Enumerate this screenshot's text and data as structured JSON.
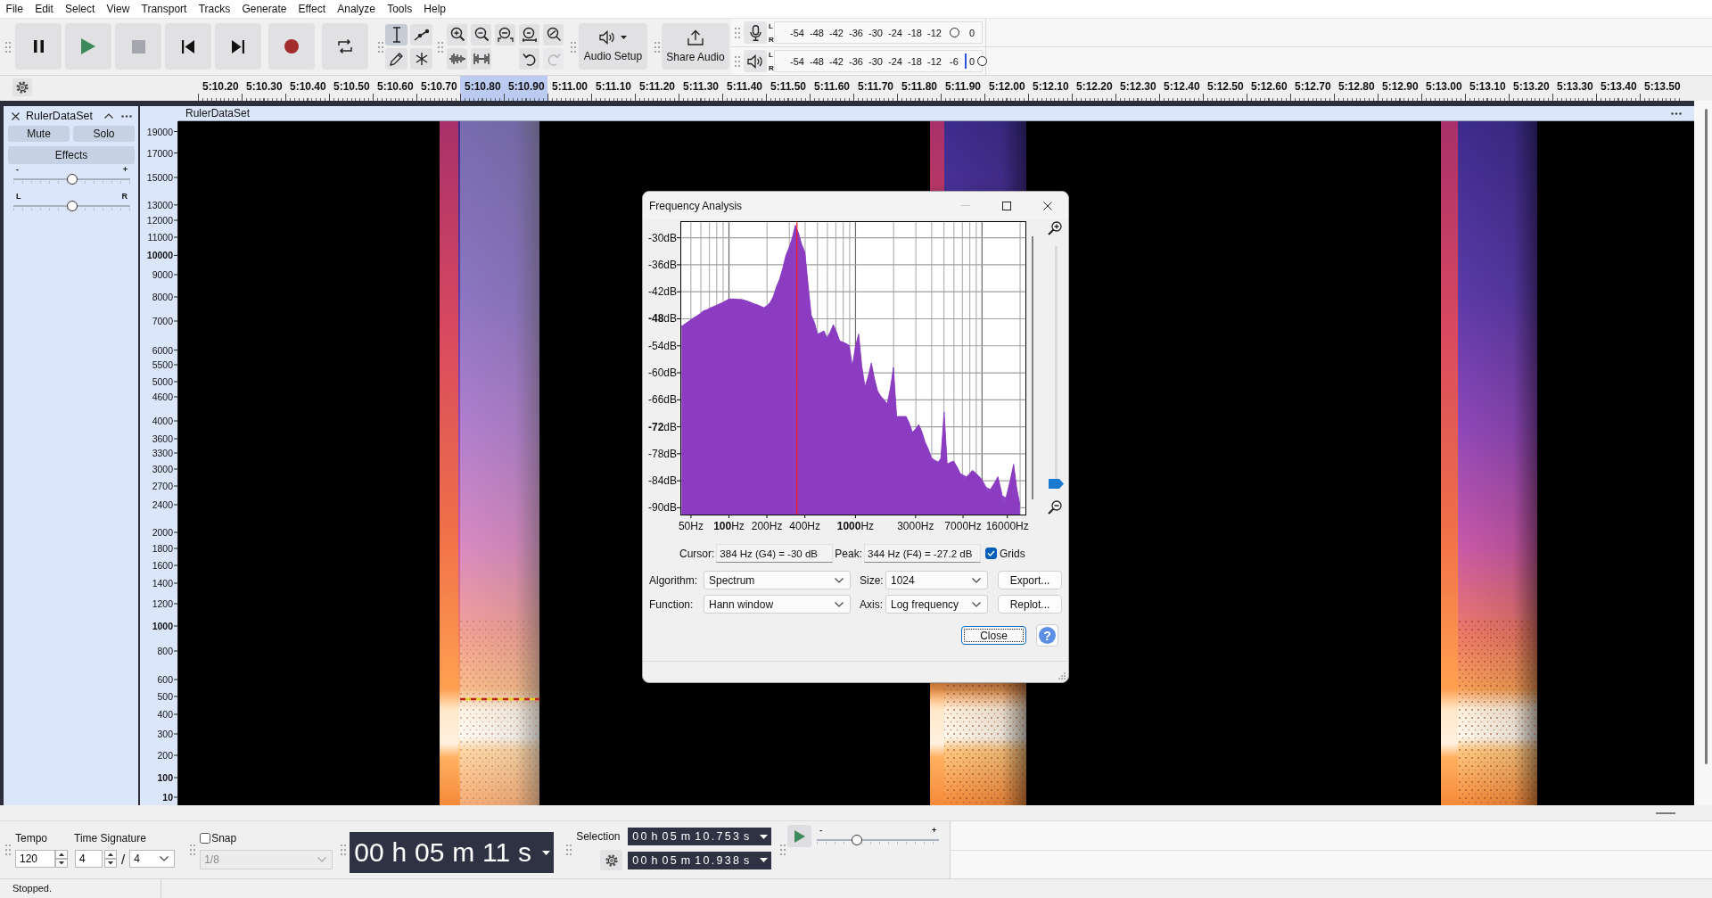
{
  "menu_bar": [
    "File",
    "Edit",
    "Select",
    "View",
    "Transport",
    "Tracks",
    "Generate",
    "Effect",
    "Analyze",
    "Tools",
    "Help"
  ],
  "tools": [
    {
      "selected": true
    },
    {
      "selected": false
    },
    {
      "selected": false
    },
    {
      "selected": false
    }
  ],
  "undo_redo": [
    {
      "disabled": false
    },
    {
      "disabled": true
    }
  ],
  "audio_setup": {
    "label": "Audio Setup"
  },
  "share_audio": {
    "label": "Share Audio"
  },
  "record_meter": {
    "channels": [
      "L",
      "R"
    ],
    "ticks": [
      "-54",
      "-48",
      "-42",
      "-36",
      "-30",
      "-24",
      "-18",
      "-12",
      "0"
    ],
    "slider": {
      "level": 0.86
    }
  },
  "playback_meter": {
    "channels": [
      "L",
      "R"
    ],
    "ticks": [
      "-54",
      "-48",
      "-42",
      "-36",
      "-30",
      "-24",
      "-18",
      "-12",
      "-6",
      "0"
    ],
    "peak": {
      "level": 0.91
    },
    "slider": {
      "level": 0.995
    }
  },
  "timeline": {
    "labels": [
      {
        "text": "5:10.20",
        "selected": false
      },
      {
        "text": "5:10.30",
        "selected": false
      },
      {
        "text": "5:10.40",
        "selected": false
      },
      {
        "text": "5:10.50",
        "selected": false
      },
      {
        "text": "5:10.60",
        "selected": false
      },
      {
        "text": "5:10.70",
        "selected": false
      },
      {
        "text": "5:10.80",
        "selected": true
      },
      {
        "text": "5:10.90",
        "selected": true
      },
      {
        "text": "5:11.00",
        "selected": false
      },
      {
        "text": "5:11.10",
        "selected": false
      },
      {
        "text": "5:11.20",
        "selected": false
      },
      {
        "text": "5:11.30",
        "selected": false
      },
      {
        "text": "5:11.40",
        "selected": false
      },
      {
        "text": "5:11.50",
        "selected": false
      },
      {
        "text": "5:11.60",
        "selected": false
      },
      {
        "text": "5:11.70",
        "selected": false
      },
      {
        "text": "5:11.80",
        "selected": false
      },
      {
        "text": "5:11.90",
        "selected": false
      },
      {
        "text": "5:12.00",
        "selected": false
      },
      {
        "text": "5:12.10",
        "selected": false
      },
      {
        "text": "5:12.20",
        "selected": false
      },
      {
        "text": "5:12.30",
        "selected": false
      },
      {
        "text": "5:12.40",
        "selected": false
      },
      {
        "text": "5:12.50",
        "selected": false
      },
      {
        "text": "5:12.60",
        "selected": false
      },
      {
        "text": "5:12.70",
        "selected": false
      },
      {
        "text": "5:12.80",
        "selected": false
      },
      {
        "text": "5:12.90",
        "selected": false
      },
      {
        "text": "5:13.00",
        "selected": false
      },
      {
        "text": "5:13.10",
        "selected": false
      },
      {
        "text": "5:13.20",
        "selected": false
      },
      {
        "text": "5:13.30",
        "selected": false
      },
      {
        "text": "5:13.40",
        "selected": false
      },
      {
        "text": "5:13.50",
        "selected": false
      }
    ]
  },
  "track": {
    "name": "RulerDataSet",
    "mute": "Mute",
    "solo": "Solo",
    "effects": "Effects",
    "gain": {
      "min_label": "-",
      "max_label": "+",
      "level": 0.5
    },
    "pan": {
      "min_label": "L",
      "max_label": "R",
      "level": 0.5
    },
    "title_bar": "RulerDataSet"
  },
  "frequency_ruler": [
    {
      "text": "19000",
      "major": false
    },
    {
      "text": "17000",
      "major": false
    },
    {
      "text": "15000",
      "major": false
    },
    {
      "text": "13000",
      "major": false
    },
    {
      "text": "12000",
      "major": false
    },
    {
      "text": "11000",
      "major": false
    },
    {
      "text": "10000",
      "major": true
    },
    {
      "text": "9000",
      "major": false
    },
    {
      "text": "8000",
      "major": false
    },
    {
      "text": "7000",
      "major": false
    },
    {
      "text": "6000",
      "major": false
    },
    {
      "text": "5500",
      "major": false
    },
    {
      "text": "5000",
      "major": false
    },
    {
      "text": "4600",
      "major": false
    },
    {
      "text": "4000",
      "major": false
    },
    {
      "text": "3600",
      "major": false
    },
    {
      "text": "3300",
      "major": false
    },
    {
      "text": "3000",
      "major": false
    },
    {
      "text": "2700",
      "major": false
    },
    {
      "text": "2400",
      "major": false
    },
    {
      "text": "2000",
      "major": false
    },
    {
      "text": "1800",
      "major": false
    },
    {
      "text": "1600",
      "major": false
    },
    {
      "text": "1400",
      "major": false
    },
    {
      "text": "1200",
      "major": false
    },
    {
      "text": "1000",
      "major": true
    },
    {
      "text": "800",
      "major": false
    },
    {
      "text": "600",
      "major": false
    },
    {
      "text": "500",
      "major": false
    },
    {
      "text": "400",
      "major": false
    },
    {
      "text": "300",
      "major": false
    },
    {
      "text": "200",
      "major": false
    },
    {
      "text": "100",
      "major": true
    },
    {
      "text": "10",
      "major": true
    }
  ],
  "frequency_analysis": {
    "title": "Frequency Analysis",
    "minimize": {
      "disabled": true
    },
    "chart_data": {
      "type": "area",
      "categories": [
        null,
        null,
        null,
        "50Hz",
        null,
        null,
        null,
        null,
        null,
        null,
        null,
        null,
        null,
        null,
        null,
        "**100**Hz",
        null,
        null,
        null,
        null,
        null,
        null,
        null,
        null,
        null,
        null,
        null,
        "200Hz",
        null,
        null,
        null,
        null,
        null,
        null,
        null,
        null,
        null,
        null,
        null,
        "400Hz",
        null,
        null,
        null,
        null,
        null,
        null,
        null,
        null,
        null,
        null,
        null,
        null,
        null,
        null,
        null,
        "**1000**Hz",
        null,
        null,
        null,
        null,
        null,
        null,
        null,
        null,
        null,
        null,
        null,
        null,
        null,
        null,
        null,
        null,
        null,
        null,
        "3000Hz",
        null,
        null,
        null,
        null,
        null,
        null,
        null,
        null,
        null,
        null,
        null,
        null,
        null,
        null,
        "7000Hz",
        null,
        null,
        null,
        null,
        null,
        null,
        null,
        null,
        null,
        null,
        null,
        null,
        null,
        "16000Hz",
        null,
        null,
        null,
        null
      ],
      "series": [
        {
          "color": "#8b3cc1",
          "values": [
            -49.7,
            -49.2,
            -48.7,
            -48.2,
            -47.7,
            -47.3,
            -46.8,
            -46.2,
            -46.0,
            -45.6,
            -45.3,
            -45.0,
            -44.7,
            -44.4,
            -44.0,
            -43.6,
            -43.6,
            -43.6,
            -43.7,
            -43.7,
            -43.9,
            -44.1,
            -44.4,
            -44.7,
            -44.9,
            -45.2,
            -45.5,
            -45.1,
            -44.4,
            -43.1,
            -40.9,
            -39.2,
            -36.8,
            -33.9,
            -32.2,
            -30.0,
            -27.2,
            -29.0,
            -31.5,
            -33.2,
            -40.3,
            -47.2,
            -48.8,
            -51.4,
            -51.1,
            -50.7,
            -52.2,
            -51.0,
            -49.3,
            -50.9,
            -52.9,
            -53.2,
            -53.5,
            -53.9,
            -58.5,
            -54.1,
            -51.4,
            -58.5,
            -63.1,
            -60.9,
            -57.8,
            -61.3,
            -64.1,
            -65.2,
            -66.0,
            -66.9,
            -63.5,
            -58.8,
            -69.7,
            -69.7,
            -69.7,
            -69.7,
            -71.2,
            -73.2,
            -72.5,
            -71.5,
            -73.1,
            -75.4,
            -76.9,
            -78.9,
            -79.5,
            -80.0,
            -79.0,
            -68.7,
            -80.3,
            -79.9,
            -79.6,
            -80.8,
            -82.2,
            -83.8,
            -83.2,
            -82.5,
            -81.7,
            -82.3,
            -83.0,
            -83.8,
            -85.1,
            -86.6,
            -85.5,
            -84.4,
            -83.1,
            -86.0,
            -89.4,
            -86.6,
            -83.6,
            -80.3,
            -85.8,
            -89.4
          ]
        }
      ],
      "ylim": [
        -91.5,
        -26.5
      ],
      "yticks": [
        {
          "value": -30,
          "label": "-30dB"
        },
        {
          "value": -36,
          "label": "-36dB"
        },
        {
          "value": -42,
          "label": "-42dB"
        },
        {
          "value": -48,
          "label": "**-48**dB"
        },
        {
          "value": -54,
          "label": "-54dB"
        },
        {
          "value": -60,
          "label": "-60dB"
        },
        {
          "value": -66,
          "label": "-66dB"
        },
        {
          "value": -72,
          "label": "**-72**dB"
        },
        {
          "value": -78,
          "label": "-78dB"
        },
        {
          "value": -84,
          "label": "-84dB"
        },
        {
          "value": -90,
          "label": "-90dB"
        }
      ],
      "grid": true
    },
    "zoom_slider": {
      "level": 0.02
    },
    "cursor": {
      "label": "Cursor:",
      "value": "384 Hz (G4) = -30 dB"
    },
    "peak": {
      "label": "Peak:",
      "value": "344 Hz (F4) = -27.2 dB"
    },
    "grids": {
      "label": "Grids",
      "checked": true
    },
    "algorithm": {
      "label": "Algorithm:",
      "value": "Spectrum"
    },
    "size": {
      "label": "Size:",
      "value": "1024"
    },
    "function": {
      "label": "Function:",
      "value": "Hann window"
    },
    "axis": {
      "label": "Axis:",
      "value": "Log frequency"
    },
    "side_buttons": [
      "Export...",
      "Replot..."
    ],
    "close_button": {
      "label": "Close",
      "focused": true
    },
    "help_button": "?"
  },
  "tempo": {
    "label": "Tempo",
    "value": "120"
  },
  "time_signature": {
    "label": "Time Signature",
    "upper": "4",
    "separator": "/",
    "lower": "4"
  },
  "snap": {
    "label": "Snap",
    "checked": false,
    "value": "1/8",
    "disabled": true
  },
  "time_display": "00 h 05 m 11 s",
  "selection": {
    "label": "Selection",
    "start": "00 h 05 m 10.753 s",
    "end": "00 h 05 m 10.938 s"
  },
  "play_at_speed": {
    "min_label": "-",
    "max_label": "+",
    "level": 0.33
  },
  "status_bar": [
    "Stopped."
  ]
}
